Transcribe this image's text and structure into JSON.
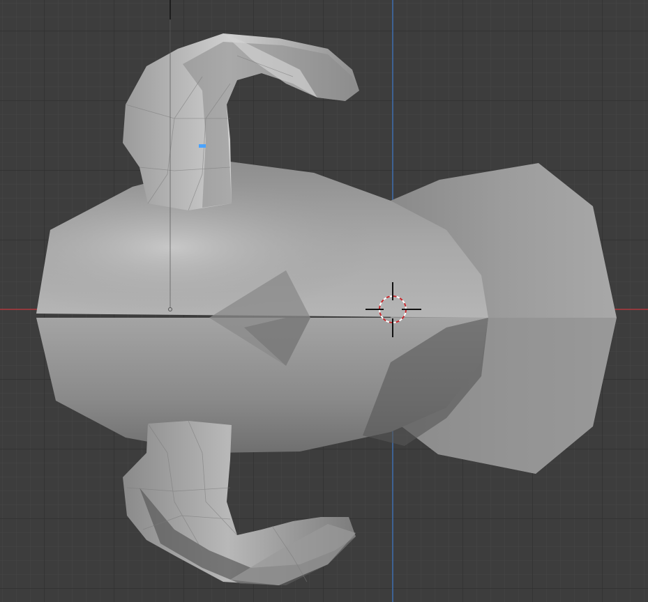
{
  "viewport": {
    "view": "top-orthographic",
    "grid": true,
    "object": "monkey-mesh",
    "colors": {
      "background": "#3d3d3d",
      "grid_minor": "#474747",
      "grid_major": "#303030",
      "x_axis": "#b03a3e",
      "y_axis": "#3f6fb0",
      "mesh_light": "#bdbdbd",
      "mesh_mid": "#9a9a9a",
      "mesh_dark": "#6c6c6c",
      "selected_vertex": "#4aa3ff"
    },
    "icons": {
      "cursor": "3d-cursor-icon",
      "light_line": "light-direction-line"
    }
  }
}
